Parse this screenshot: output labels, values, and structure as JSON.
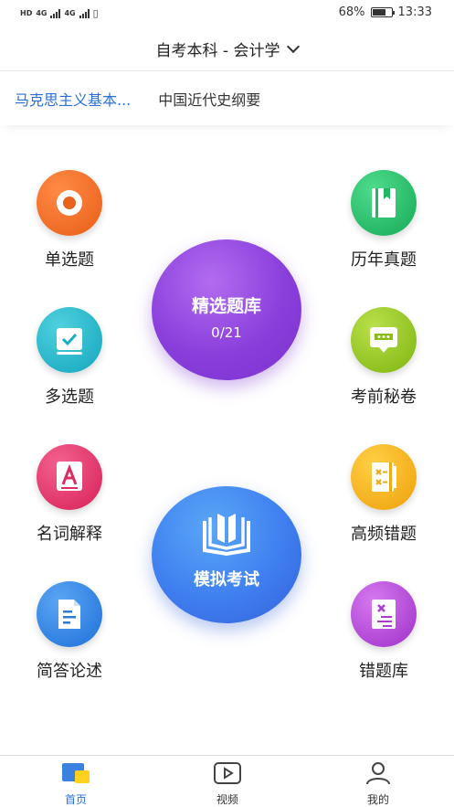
{
  "status_bar": {
    "left_text": "HD",
    "network_1": "4G",
    "network_2": "4G",
    "battery": "68%",
    "battery_level": 0.68,
    "time": "13:33"
  },
  "header": {
    "title": "自考本科 - 会计学"
  },
  "subject_tabs": [
    {
      "label": "马克思主义基本..."
    },
    {
      "label": "中国近代史纲要"
    }
  ],
  "menu": {
    "left": [
      {
        "label": "单选题",
        "icon": "target-icon",
        "color": "#ee6a23"
      },
      {
        "label": "多选题",
        "icon": "checkbox-icon",
        "color": "#1fb5c9"
      },
      {
        "label": "名词解释",
        "icon": "letter-a-icon",
        "color": "#e5336b"
      },
      {
        "label": "简答论述",
        "icon": "document-icon",
        "color": "#2f86e6"
      }
    ],
    "right": [
      {
        "label": "历年真题",
        "icon": "book-icon",
        "color": "#22c16a"
      },
      {
        "label": "考前秘卷",
        "icon": "message-icon",
        "color": "#96c81d"
      },
      {
        "label": "高频错题",
        "icon": "notebook-icon",
        "color": "#f3b11b"
      },
      {
        "label": "错题库",
        "icon": "error-list-icon",
        "color": "#b044d6"
      }
    ]
  },
  "featured": {
    "question_bank": {
      "title": "精选题库",
      "progress": "0/21",
      "color": "#8a3fdc"
    },
    "mock_exam": {
      "title": "模拟考试",
      "icon": "open-book-icon",
      "color": "#3f7ff0"
    }
  },
  "bottom_nav": [
    {
      "label": "首页",
      "icon": "home-icon",
      "active": true
    },
    {
      "label": "视频",
      "icon": "video-icon",
      "active": false
    },
    {
      "label": "我的",
      "icon": "profile-icon",
      "active": false
    }
  ],
  "colors": {
    "accent": "#2b6fd6"
  }
}
